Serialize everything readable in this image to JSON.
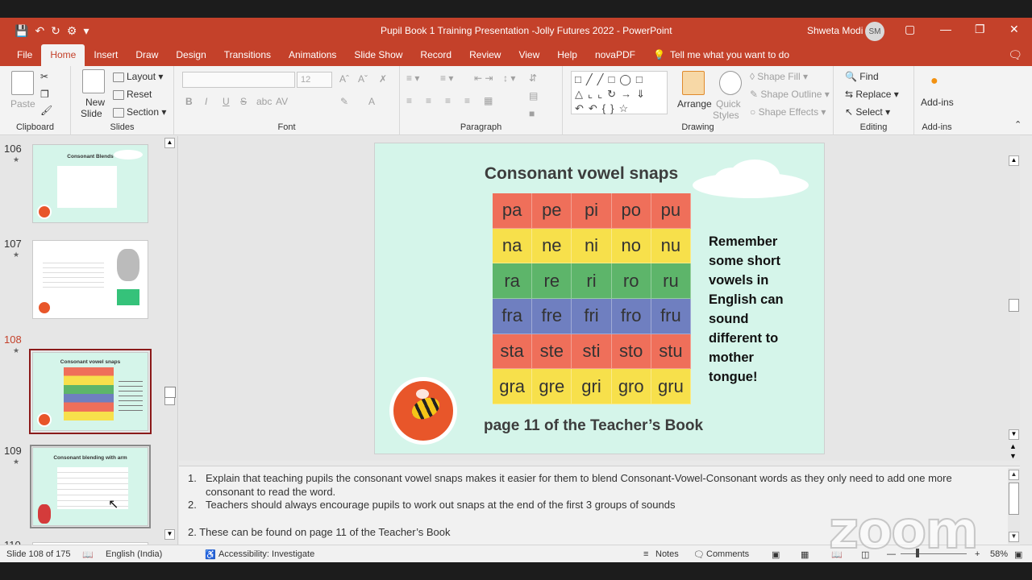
{
  "window": {
    "title": "Pupil Book 1 Training Presentation -Jolly Futures 2022  -  PowerPoint",
    "user_name": "Shweta Modi",
    "user_initials": "SM"
  },
  "menu_tabs": [
    "File",
    "Home",
    "Insert",
    "Draw",
    "Design",
    "Transitions",
    "Animations",
    "Slide Show",
    "Record",
    "Review",
    "View",
    "Help",
    "novaPDF"
  ],
  "tell_me": "Tell me what you want to do",
  "ribbon": {
    "clipboard": {
      "label": "Clipboard",
      "paste": "Paste"
    },
    "slides": {
      "label": "Slides",
      "new_slide_1": "New",
      "new_slide_2": "Slide",
      "layout": "Layout",
      "reset": "Reset",
      "section": "Section"
    },
    "font": {
      "label": "Font",
      "size": "12",
      "bold": "B",
      "italic": "I",
      "underline": "U",
      "strike": "S",
      "shadow": "abc",
      "spacing": "AV",
      "color": "A"
    },
    "paragraph": {
      "label": "Paragraph"
    },
    "drawing": {
      "label": "Drawing",
      "arrange": "Arrange",
      "quick_styles_1": "Quick",
      "quick_styles_2": "Styles",
      "shape_fill": "Shape Fill",
      "shape_outline": "Shape Outline",
      "shape_effects": "Shape Effects"
    },
    "editing": {
      "label": "Editing",
      "find": "Find",
      "replace": "Replace",
      "select": "Select"
    },
    "addins": {
      "label": "Add-ins",
      "addins": "Add-ins"
    }
  },
  "thumbnails": [
    {
      "number": "106",
      "title": "Consonant Blends"
    },
    {
      "number": "107",
      "title": ""
    },
    {
      "number": "108",
      "title": "Consonant vowel snaps"
    },
    {
      "number": "109",
      "title": "Consonant blending with arm"
    },
    {
      "number": "110",
      "title": ""
    }
  ],
  "slide": {
    "title": "Consonant vowel snaps",
    "rows": [
      {
        "color": "#ef6f5a",
        "cells": [
          "pa",
          "pe",
          "pi",
          "po",
          "pu"
        ]
      },
      {
        "color": "#f7e04b",
        "cells": [
          "na",
          "ne",
          "ni",
          "no",
          "nu"
        ]
      },
      {
        "color": "#5db56a",
        "cells": [
          "ra",
          "re",
          "ri",
          "ro",
          "ru"
        ]
      },
      {
        "color": "#6f7fc0",
        "cells": [
          "fra",
          "fre",
          "fri",
          "fro",
          "fru"
        ]
      },
      {
        "color": "#ef6f5a",
        "cells": [
          "sta",
          "ste",
          "sti",
          "sto",
          "stu"
        ]
      },
      {
        "color": "#f7e04b",
        "cells": [
          "gra",
          "gre",
          "gri",
          "gro",
          "gru"
        ]
      }
    ],
    "remember": "Remember some short vowels in English can sound different to mother tongue!",
    "page_ref": "page 11 of the Teacher’s Book"
  },
  "notes": {
    "item1_num": "1.",
    "item1_line1": "Explain that teaching pupils the consonant vowel snaps makes it easier for them to blend Consonant-Vowel-Consonant words as they only need to add one more",
    "item1_line2": "consonant to read the word.",
    "item2_num": "2.",
    "item2": "Teachers should always encourage pupils to work out snaps at the end of the first 3 groups of sounds",
    "item3": "2. These can be found on page 11 of the Teacher’s Book"
  },
  "status": {
    "slide_count": "Slide 108 of 175",
    "language": "English (India)",
    "accessibility": "Accessibility: Investigate",
    "notes": "Notes",
    "comments": "Comments",
    "zoom": "58%"
  },
  "watermark": "zoom"
}
